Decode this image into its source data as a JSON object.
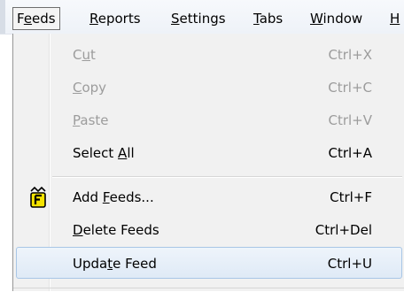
{
  "menubar": {
    "items": [
      {
        "label_pre": "F",
        "label_u": "e",
        "label_post": "eds"
      },
      {
        "label_pre": "",
        "label_u": "R",
        "label_post": "eports"
      },
      {
        "label_pre": "",
        "label_u": "S",
        "label_post": "ettings"
      },
      {
        "label_pre": "",
        "label_u": "T",
        "label_post": "abs"
      },
      {
        "label_pre": "",
        "label_u": "W",
        "label_post": "indow"
      },
      {
        "label_pre": "",
        "label_u": "H",
        "label_post": ""
      }
    ]
  },
  "dropdown": {
    "items": [
      {
        "label_pre": "C",
        "label_u": "u",
        "label_post": "t",
        "shortcut": "Ctrl+X",
        "enabled": false
      },
      {
        "label_pre": "",
        "label_u": "C",
        "label_post": "opy",
        "shortcut": "Ctrl+C",
        "enabled": false
      },
      {
        "label_pre": "",
        "label_u": "P",
        "label_post": "aste",
        "shortcut": "Ctrl+V",
        "enabled": false
      },
      {
        "label_pre": "Select ",
        "label_u": "A",
        "label_post": "ll",
        "shortcut": "Ctrl+A",
        "enabled": true
      },
      {
        "label_pre": "Add ",
        "label_u": "F",
        "label_post": "eeds...",
        "shortcut": "Ctrl+F",
        "enabled": true,
        "icon": "feed-add-icon"
      },
      {
        "label_pre": "",
        "label_u": "D",
        "label_post": "elete Feeds",
        "shortcut": "Ctrl+Del",
        "enabled": true
      },
      {
        "label_pre": "Upda",
        "label_u": "t",
        "label_post": "e Feed",
        "shortcut": "Ctrl+U",
        "enabled": true,
        "highlighted": true
      }
    ]
  },
  "colors": {
    "highlight_border": "#a8c6e6",
    "disabled_text": "#9c9c9c",
    "menu_background": "#f1f1f1"
  }
}
